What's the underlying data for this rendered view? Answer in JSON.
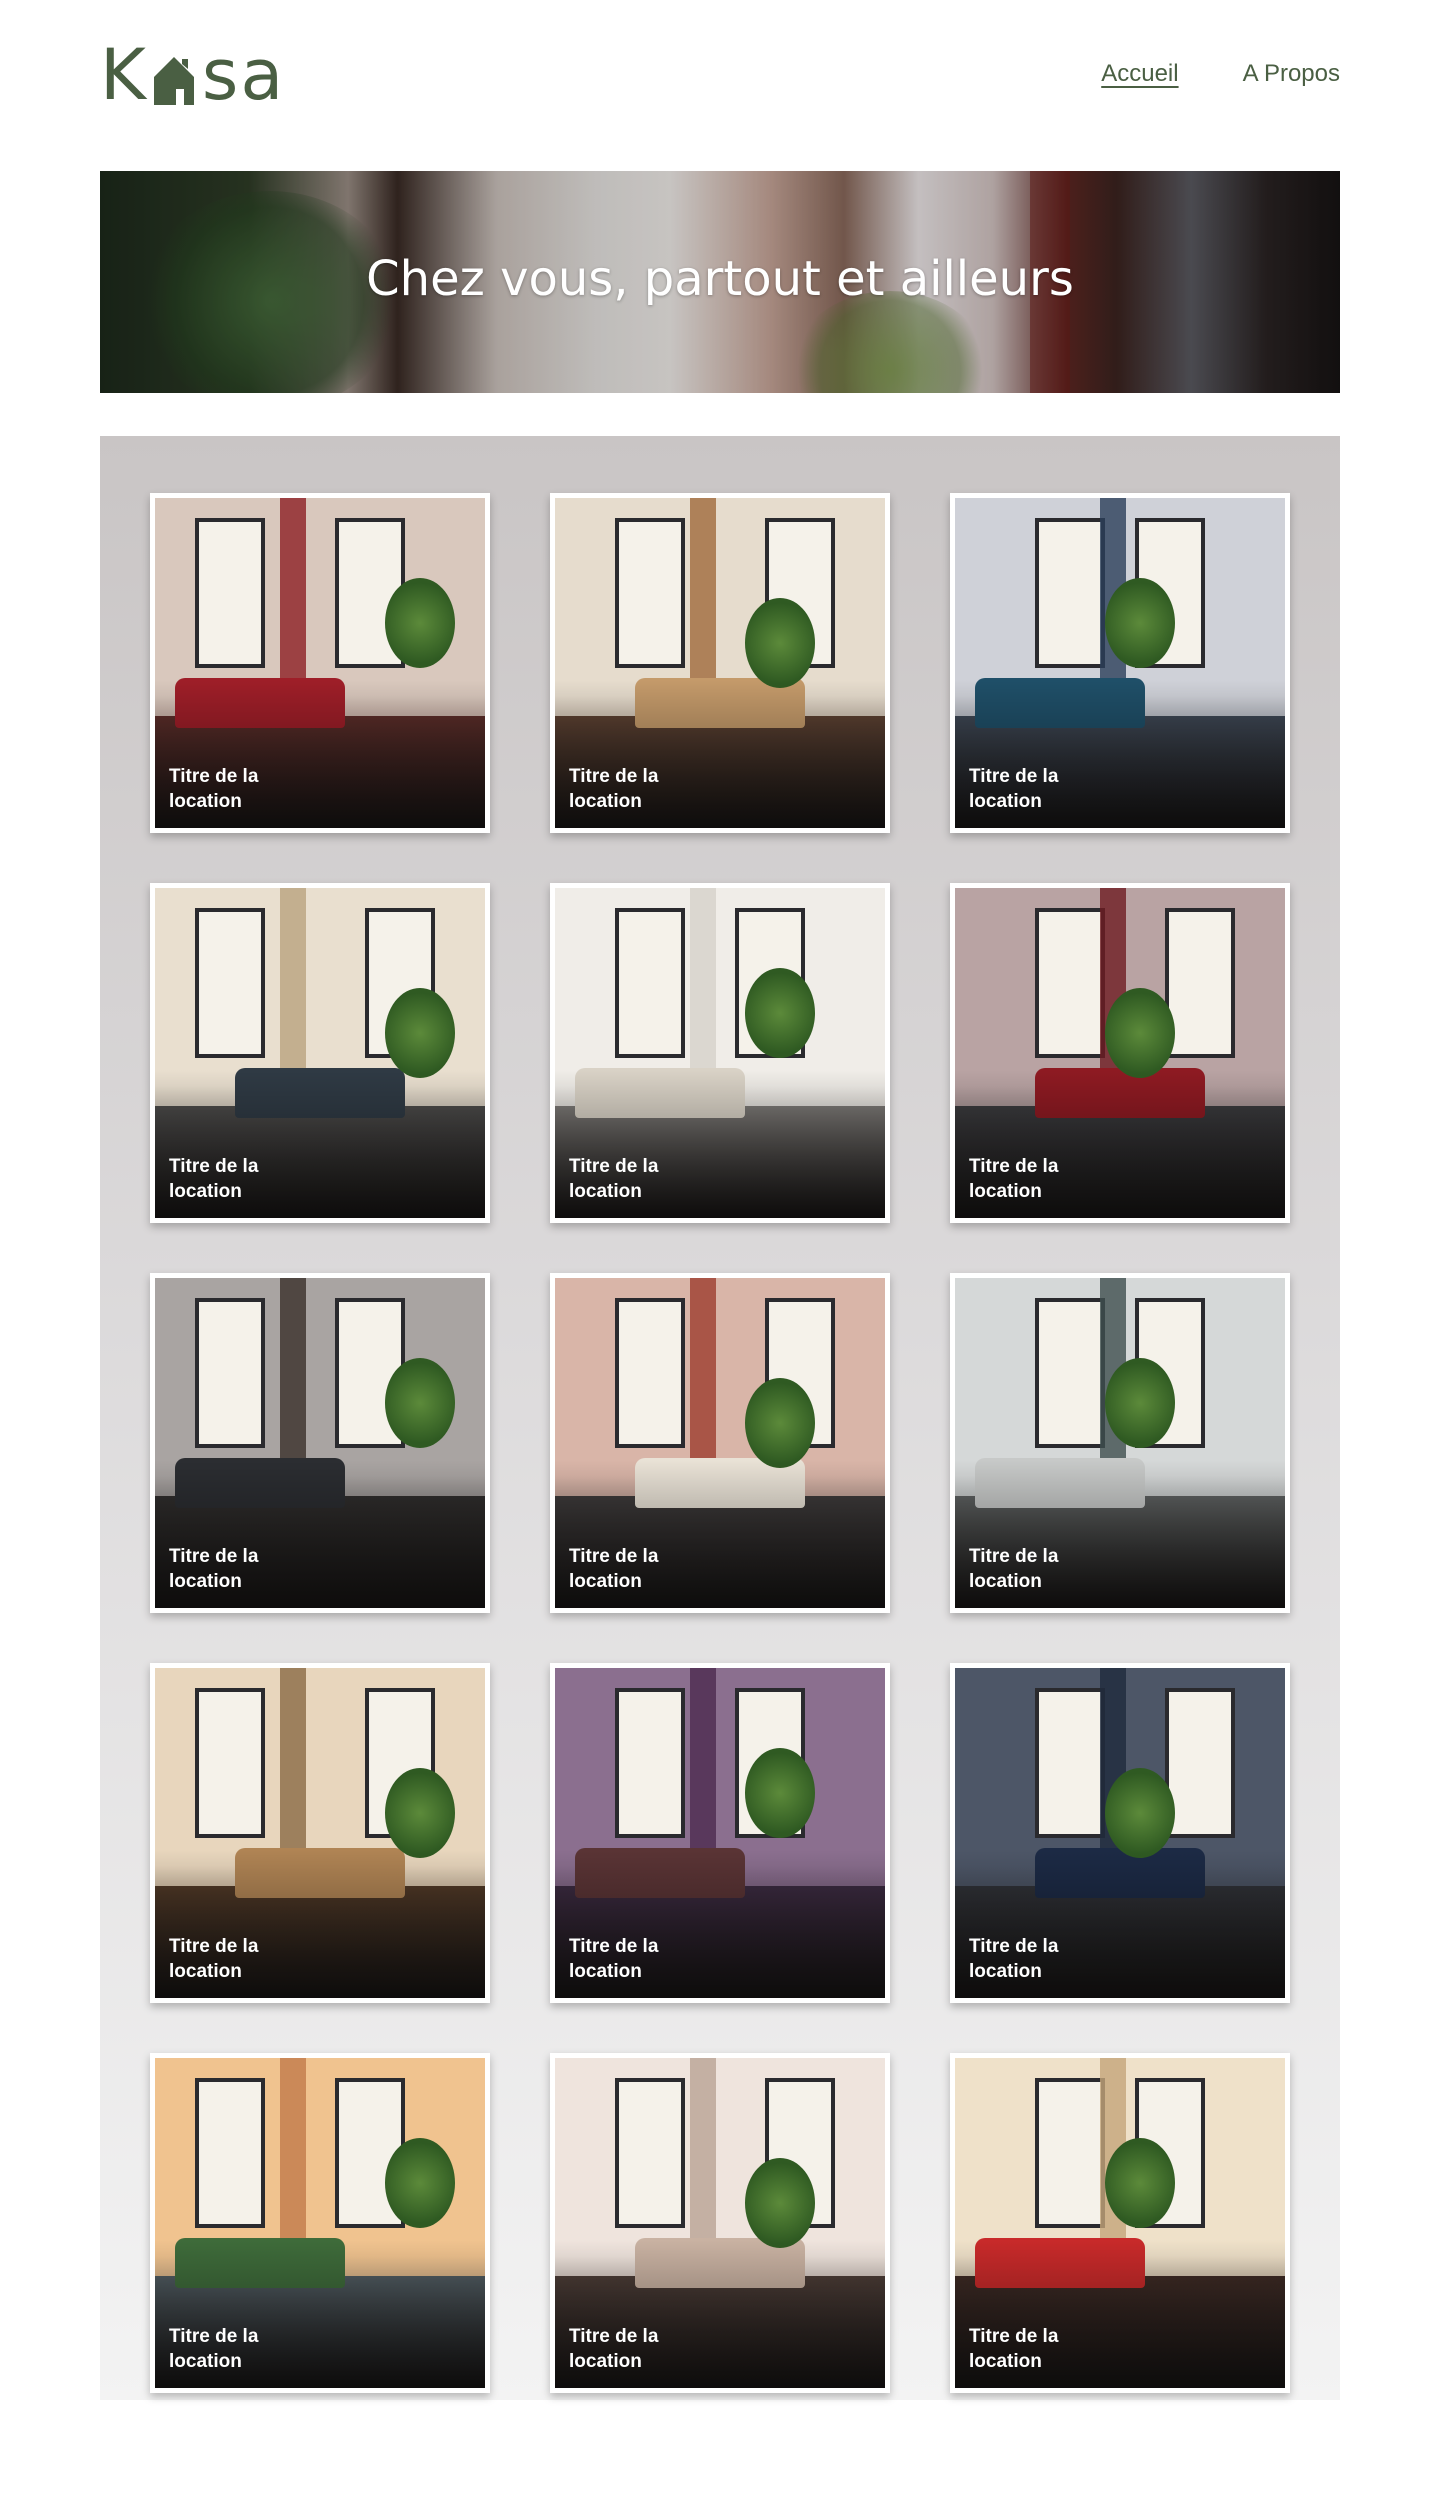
{
  "logo": {
    "text_before": "K",
    "text_after": "sa"
  },
  "nav": {
    "home": "Accueil",
    "about": "A Propos"
  },
  "banner": {
    "title": "Chez vous, partout et ailleurs"
  },
  "cards": [
    {
      "title": "Titre de la location",
      "wall": "#d9c8bd",
      "accent": "#8c1f24",
      "floor": "#5a2c28",
      "sofa": "#9e1e28"
    },
    {
      "title": "Titre de la location",
      "wall": "#e6dccd",
      "accent": "#a06a3c",
      "floor": "#5b4031",
      "sofa": "#c49a6a"
    },
    {
      "title": "Titre de la location",
      "wall": "#cfd1d8",
      "accent": "#2b3e5a",
      "floor": "#3d4653",
      "sofa": "#1f4f68"
    },
    {
      "title": "Titre de la location",
      "wall": "#e9dfcf",
      "accent": "#b9a37e",
      "floor": "#4b4a49",
      "sofa": "#2f3a44"
    },
    {
      "title": "Titre de la location",
      "wall": "#f0ede8",
      "accent": "#d6d1c9",
      "floor": "#7a7774",
      "sofa": "#d9d2c6"
    },
    {
      "title": "Titre de la location",
      "wall": "#b9a3a3",
      "accent": "#6e1b22",
      "floor": "#3a3a3d",
      "sofa": "#8e1a22"
    },
    {
      "title": "Titre de la location",
      "wall": "#a9a4a2",
      "accent": "#3a302b",
      "floor": "#2f2d2c",
      "sofa": "#2b2d31"
    },
    {
      "title": "Titre de la location",
      "wall": "#d9b5a8",
      "accent": "#9c3d2e",
      "floor": "#3d3a3a",
      "sofa": "#e9e2d6"
    },
    {
      "title": "Titre de la location",
      "wall": "#d5d8d8",
      "accent": "#3e4f4f",
      "floor": "#5d6060",
      "sofa": "#c7c9c8"
    },
    {
      "title": "Titre de la location",
      "wall": "#e8d6bd",
      "accent": "#8a6a45",
      "floor": "#4f3826",
      "sofa": "#b08454"
    },
    {
      "title": "Titre de la location",
      "wall": "#8b6f8f",
      "accent": "#4c2b4f",
      "floor": "#3b2a40",
      "sofa": "#5a3435"
    },
    {
      "title": "Titre de la location",
      "wall": "#4d5667",
      "accent": "#1f2a3d",
      "floor": "#2f3136",
      "sofa": "#1c2a45"
    },
    {
      "title": "Titre de la location",
      "wall": "#f0c38f",
      "accent": "#c27a4a",
      "floor": "#4f5a60",
      "sofa": "#3e6b3a"
    },
    {
      "title": "Titre de la location",
      "wall": "#efe4dd",
      "accent": "#b9a295",
      "floor": "#4b3c36",
      "sofa": "#c9b2a2"
    },
    {
      "title": "Titre de la location",
      "wall": "#efe1c9",
      "accent": "#c4a57a",
      "floor": "#3d2a24",
      "sofa": "#c82a2a"
    }
  ]
}
